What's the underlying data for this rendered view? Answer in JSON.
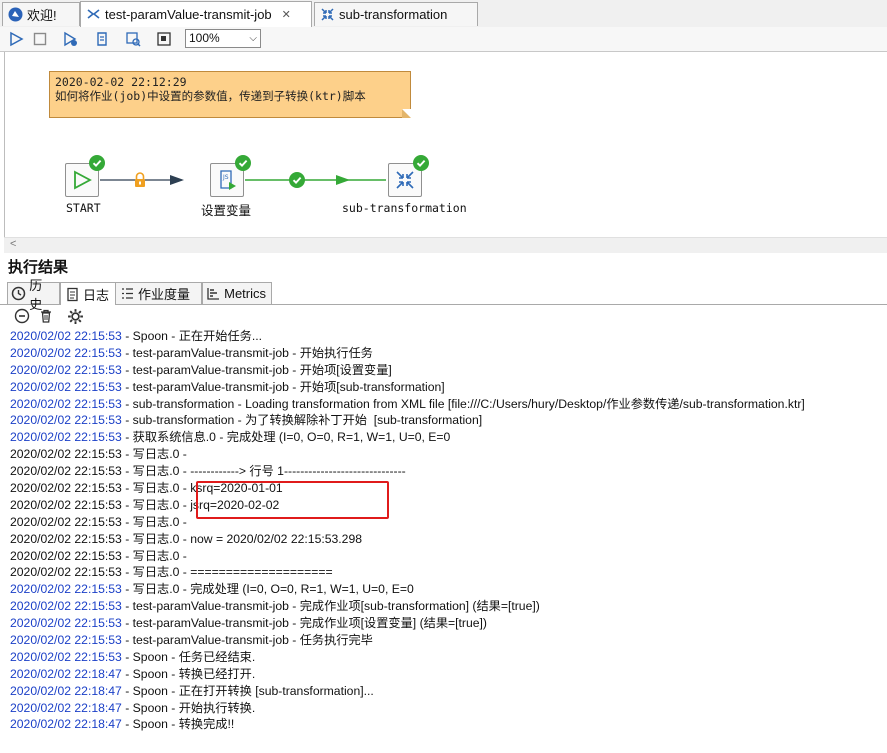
{
  "tabs": [
    {
      "label": "欢迎!",
      "icon": "spoon-logo-icon"
    },
    {
      "label": "test-paramValue-transmit-job",
      "icon": "job-icon",
      "active": true,
      "close": "✕"
    },
    {
      "label": "sub-transformation",
      "icon": "transformation-icon"
    }
  ],
  "toolbar": {
    "zoom": "100%",
    "buttons": [
      "run-icon",
      "stop-icon",
      "run-options-icon",
      "replay-icon",
      "preview-icon",
      "show-results-icon"
    ]
  },
  "canvas": {
    "note": {
      "line1": "2020-02-02 22:12:29",
      "line2": "如何将作业(job)中设置的参数值，传递到子转换(ktr)脚本"
    },
    "nodes": [
      {
        "label": "START"
      },
      {
        "label": "设置变量"
      },
      {
        "label": "sub-transformation"
      }
    ]
  },
  "results": {
    "title": "执行结果",
    "tabs": [
      {
        "label": "历史",
        "icon": "history-icon"
      },
      {
        "label": "日志",
        "icon": "log-icon",
        "active": true
      },
      {
        "label": "作业度量",
        "icon": "job-metrics-icon"
      },
      {
        "label": "Metrics",
        "icon": "metrics-icon"
      }
    ],
    "tools": [
      "stop-icon",
      "clear-log-icon",
      "log-settings-icon"
    ],
    "log": [
      {
        "ts": "2020/02/02 22:15:53",
        "msg": " - Spoon - 正在开始任务...",
        "blue": true
      },
      {
        "ts": "2020/02/02 22:15:53",
        "msg": " - test-paramValue-transmit-job - 开始执行任务",
        "blue": true
      },
      {
        "ts": "2020/02/02 22:15:53",
        "msg": " - test-paramValue-transmit-job - 开始项[设置变量]",
        "blue": true
      },
      {
        "ts": "2020/02/02 22:15:53",
        "msg": " - test-paramValue-transmit-job - 开始项[sub-transformation]",
        "blue": true
      },
      {
        "ts": "2020/02/02 22:15:53",
        "msg": " - sub-transformation - Loading transformation from XML file [file:///C:/Users/hury/Desktop/作业参数传递/sub-transformation.ktr]",
        "blue": true
      },
      {
        "ts": "2020/02/02 22:15:53",
        "msg": " - sub-transformation - 为了转换解除补丁开始  [sub-transformation]",
        "blue": true
      },
      {
        "ts": "2020/02/02 22:15:53",
        "msg": " - 获取系统信息.0 - 完成处理 (I=0, O=0, R=1, W=1, U=0, E=0",
        "blue": true
      },
      {
        "ts": "2020/02/02 22:15:53",
        "msg": " - 写日志.0 -",
        "blue": false
      },
      {
        "ts": "2020/02/02 22:15:53",
        "msg": " - 写日志.0 - ------------> 行号 1------------------------------",
        "blue": false
      },
      {
        "ts": "2020/02/02 22:15:53",
        "msg": " - 写日志.0 - ksrq=2020-01-01",
        "blue": false
      },
      {
        "ts": "2020/02/02 22:15:53",
        "msg": " - 写日志.0 - jsrq=2020-02-02",
        "blue": false
      },
      {
        "ts": "2020/02/02 22:15:53",
        "msg": " - 写日志.0 -",
        "blue": false
      },
      {
        "ts": "2020/02/02 22:15:53",
        "msg": " - 写日志.0 - now = 2020/02/02 22:15:53.298",
        "blue": false
      },
      {
        "ts": "2020/02/02 22:15:53",
        "msg": " - 写日志.0 -",
        "blue": false
      },
      {
        "ts": "2020/02/02 22:15:53",
        "msg": " - 写日志.0 - ====================",
        "blue": false
      },
      {
        "ts": "2020/02/02 22:15:53",
        "msg": " - 写日志.0 - 完成处理 (I=0, O=0, R=1, W=1, U=0, E=0",
        "blue": true
      },
      {
        "ts": "2020/02/02 22:15:53",
        "msg": " - test-paramValue-transmit-job - 完成作业项[sub-transformation] (结果=[true])",
        "blue": true
      },
      {
        "ts": "2020/02/02 22:15:53",
        "msg": " - test-paramValue-transmit-job - 完成作业项[设置变量] (结果=[true])",
        "blue": true
      },
      {
        "ts": "2020/02/02 22:15:53",
        "msg": " - test-paramValue-transmit-job - 任务执行完毕",
        "blue": true
      },
      {
        "ts": "2020/02/02 22:15:53",
        "msg": " - Spoon - 任务已经结束.",
        "blue": true
      },
      {
        "ts": "2020/02/02 22:18:47",
        "msg": " - Spoon - 转换已经打开.",
        "blue": true
      },
      {
        "ts": "2020/02/02 22:18:47",
        "msg": " - Spoon - 正在打开转换 [sub-transformation]...",
        "blue": true
      },
      {
        "ts": "2020/02/02 22:18:47",
        "msg": " - Spoon - 开始执行转换.",
        "blue": true
      },
      {
        "ts": "2020/02/02 22:18:47",
        "msg": " - Spoon - 转换完成!!",
        "blue": true
      }
    ]
  },
  "colors": {
    "log_blue": "#1a3fc7",
    "success_green": "#35a937",
    "note_bg": "#fdd08a",
    "highlight_red": "#e01b1b"
  }
}
